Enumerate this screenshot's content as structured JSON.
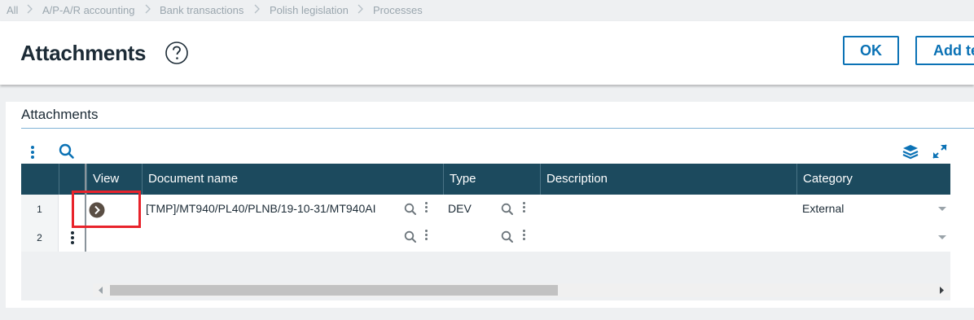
{
  "breadcrumb": {
    "items": [
      "All",
      "A/P-A/R accounting",
      "Bank transactions",
      "Polish legislation",
      "Processes"
    ]
  },
  "header": {
    "title": "Attachments",
    "help_icon": "question-circle-icon",
    "ok_label": "OK",
    "add_label": "Add te"
  },
  "section": {
    "title": "Attachments"
  },
  "toolbar": {
    "icons": [
      "more-vertical-icon",
      "search-icon",
      "layers-icon",
      "expand-icon"
    ]
  },
  "table": {
    "columns": [
      "View",
      "Document name",
      "Type",
      "Description",
      "Category"
    ],
    "rows": [
      {
        "num": "1",
        "view_icon": "chevron-right-circle-icon",
        "document_name": "[TMP]/MT940/PL40/PLNB/19-10-31/MT940AI",
        "type": "DEV",
        "description": "",
        "category": "External"
      },
      {
        "num": "2",
        "document_name": "",
        "type": "",
        "description": "",
        "category": ""
      }
    ]
  },
  "colors": {
    "header_bg": "#1c4a5e",
    "accent": "#0b72b5",
    "highlight": "#e8232b"
  }
}
